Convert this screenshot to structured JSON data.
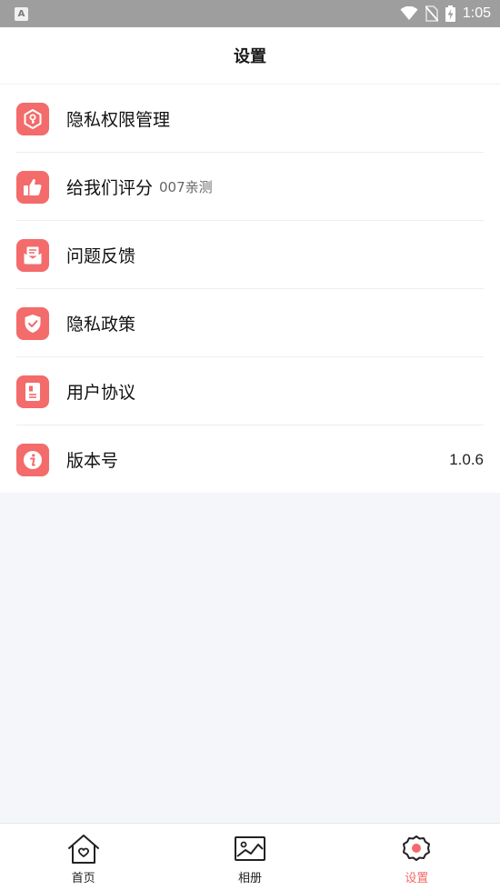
{
  "status_bar": {
    "app_icon_text": "A",
    "time": "1:05"
  },
  "header": {
    "title": "设置"
  },
  "settings": [
    {
      "label": "隐私权限管理",
      "icon": "privacy-permission-icon"
    },
    {
      "label": "给我们评分",
      "sub": "007亲测",
      "icon": "thumbs-up-icon"
    },
    {
      "label": "问题反馈",
      "icon": "feedback-mail-icon"
    },
    {
      "label": "隐私政策",
      "icon": "shield-check-icon"
    },
    {
      "label": "用户协议",
      "icon": "document-icon"
    },
    {
      "label": "版本号",
      "value": "1.0.6",
      "icon": "info-icon"
    }
  ],
  "bottom_nav": [
    {
      "label": "首页",
      "icon": "home-heart-icon"
    },
    {
      "label": "相册",
      "icon": "picture-icon"
    },
    {
      "label": "设置",
      "icon": "settings-gear-icon",
      "active": true
    }
  ],
  "colors": {
    "accent": "#f36b6b",
    "background": "#f5f6fa",
    "status_bar": "#9e9e9e"
  }
}
